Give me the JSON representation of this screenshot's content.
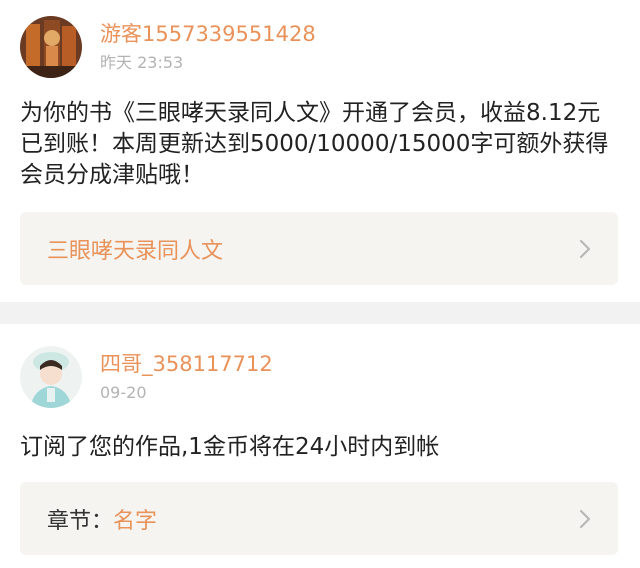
{
  "notifications": [
    {
      "username": "游客1557339551428",
      "time": "昨天 23:53",
      "message": "为你的书《三眼哮天录同人文》开通了会员，收益8.12元已到账！本周更新达到5000/10000/15000字可额外获得会员分成津贴哦！",
      "link_title": "三眼哮天录同人文"
    },
    {
      "username": "四哥_358117712",
      "time": "09-20",
      "message": "订阅了您的作品,1金币将在24小时内到帐",
      "link_prefix": "章节：",
      "link_title": "名字"
    }
  ],
  "colors": {
    "accent": "#e9925a",
    "box_bg": "#f5f4f0",
    "divider": "#f2f2f2"
  },
  "icons": {
    "chevron": "chevron-right-icon"
  }
}
